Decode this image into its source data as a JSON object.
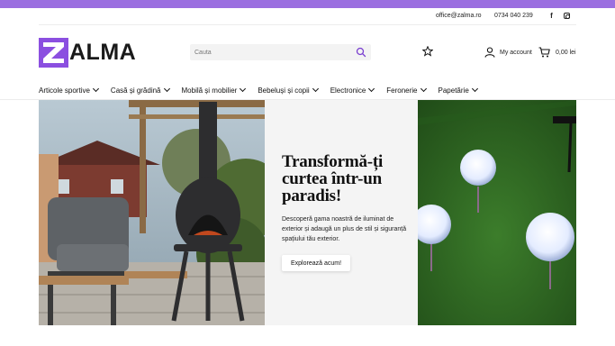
{
  "contact": {
    "email": "office@zalma.ro",
    "phone": "0734 040 239",
    "facebook_glyph": "f"
  },
  "brand": {
    "name": "ALMA",
    "logo_color": "#8b4fe0",
    "accent_color": "#9b6fe0"
  },
  "search": {
    "placeholder": "Cauta"
  },
  "header": {
    "account_label": "My account",
    "cart_total": "0,00 lei"
  },
  "nav": {
    "items": [
      {
        "label": "Articole sportive"
      },
      {
        "label": "Casă și grădină"
      },
      {
        "label": "Mobilă și mobilier"
      },
      {
        "label": "Bebeluși și copii"
      },
      {
        "label": "Electronice"
      },
      {
        "label": "Feronerie"
      },
      {
        "label": "Papetărie"
      }
    ]
  },
  "hero": {
    "title": "Transformă-ți curtea într-un paradis!",
    "description": "Descoperă gama noastră de iluminat de exterior și adaugă un plus de stil și siguranță spațiului tău exterior.",
    "cta_label": "Explorează acum!"
  },
  "icons": [
    "facebook-icon",
    "instagram-icon",
    "search-icon",
    "star-icon",
    "user-icon",
    "cart-icon",
    "chevron-down-icon"
  ]
}
